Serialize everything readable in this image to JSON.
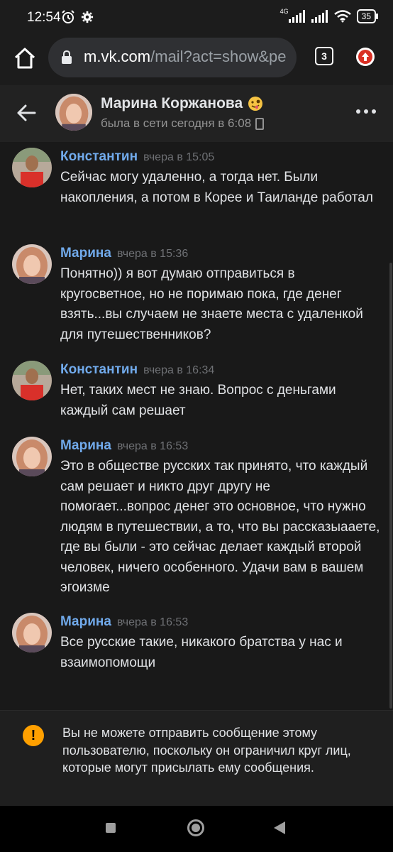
{
  "status_bar": {
    "time": "12:54",
    "network": "4G",
    "battery": "35"
  },
  "browser": {
    "url_host": "m.vk.com",
    "url_path": "/mail?act=show&pe",
    "tab_count": "3"
  },
  "chat": {
    "title": "Марина Коржанова",
    "status": "была в сети сегодня в 6:08"
  },
  "messages": [
    {
      "author": "Константин",
      "time": "вчера в 15:05",
      "text": "Сейчас могу удаленно, а тогда нет. Были накопления, а потом в Корее и Таиланде работал"
    },
    {
      "author": "Марина",
      "time": "вчера в 15:36",
      "text": "Понятно)) я вот думаю отправиться в кругосветное, но не поримаю пока, где денег взять...вы случаем не знаете места с удаленкой для путешественников?"
    },
    {
      "author": "Константин",
      "time": "вчера в 16:34",
      "text": "Нет, таких мест не знаю. Вопрос с деньгами каждый сам решает"
    },
    {
      "author": "Марина",
      "time": "вчера в 16:53",
      "text": "Это в обществе русских так принято, что каждый сам решает и никто друг другу не помогает...вопрос денег это основное, что нужно людям в путешествии, а то, что вы рассказыааете, где вы были - это сейчас делает каждый второй человек, ничего особенного. Удачи вам в вашем эгоизме"
    },
    {
      "author": "Марина",
      "time": "вчера в 16:53",
      "text": "Все русские такие, никакого братства у нас и взаимопомощи"
    }
  ],
  "notice": {
    "text": "Вы не можете отправить сообщение этому пользователю, поскольку он ограничил круг лиц, которые могут присылать ему сообщения."
  },
  "colors": {
    "author_link": "#71aaeb",
    "background": "#191919",
    "warning": "#ffa000"
  }
}
